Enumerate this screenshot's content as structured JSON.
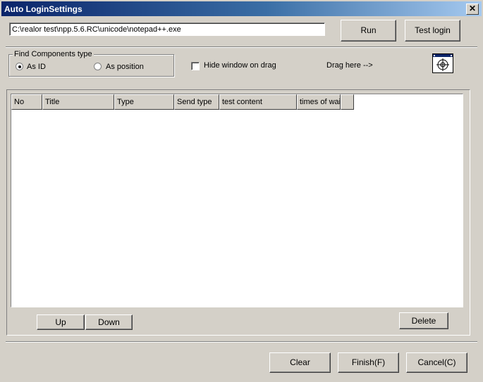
{
  "window": {
    "title": "Auto LoginSettings",
    "close_label": "✕"
  },
  "path_input": {
    "value": "C:\\realor test\\npp.5.6.RC\\unicode\\notepad++.exe"
  },
  "buttons": {
    "run": "Run",
    "test_login": "Test login",
    "up": "Up",
    "down": "Down",
    "delete": "Delete",
    "clear": "Clear",
    "finish": "Finish(F)",
    "cancel": "Cancel(C)"
  },
  "find_components": {
    "label": "Find Components type",
    "options": [
      {
        "label": "As ID",
        "checked": true
      },
      {
        "label": "As position",
        "checked": false
      }
    ]
  },
  "hide_window": {
    "label": "Hide window on drag",
    "checked": false
  },
  "drag_label": "Drag here -->",
  "drag_icon": "crosshair-target-icon",
  "table": {
    "columns": [
      "No",
      "Title",
      "Type",
      "Send type",
      "test content",
      "times of wait"
    ],
    "rows": []
  },
  "colors": {
    "face": "#d4d0c8",
    "titlebar_start": "#0a246a",
    "titlebar_end": "#a6caf0"
  }
}
